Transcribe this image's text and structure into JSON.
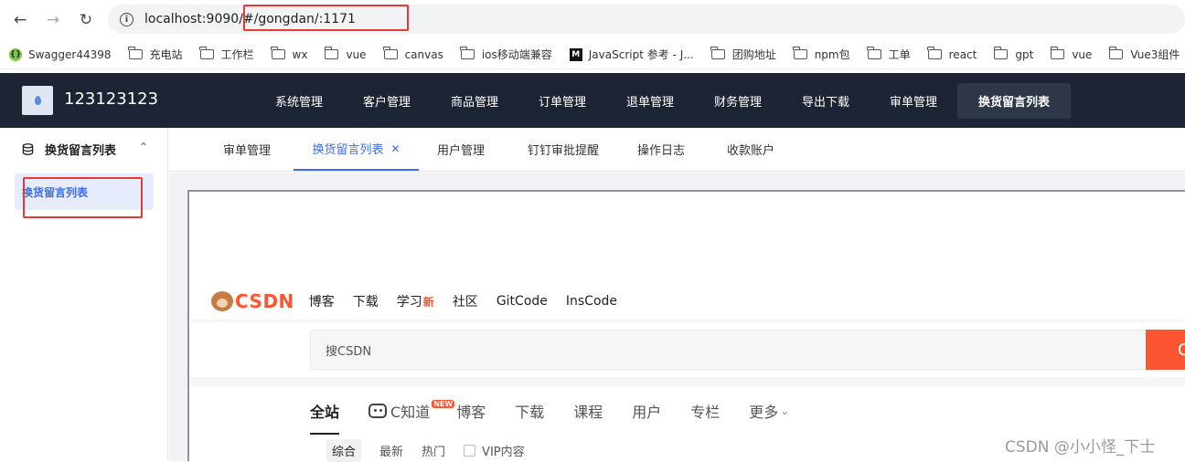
{
  "browser": {
    "url": "localhost:9090/#/gongdan/:1171",
    "bookmarks": [
      {
        "label": "Swagger44398",
        "icon": "swagger-icon"
      },
      {
        "label": "充电站",
        "icon": "folder-icon"
      },
      {
        "label": "工作栏",
        "icon": "folder-icon"
      },
      {
        "label": "wx",
        "icon": "folder-icon"
      },
      {
        "label": "vue",
        "icon": "folder-icon"
      },
      {
        "label": "canvas",
        "icon": "folder-icon"
      },
      {
        "label": "ios移动端兼容",
        "icon": "folder-icon"
      },
      {
        "label": "JavaScript 参考 - J...",
        "icon": "mdn-icon"
      },
      {
        "label": "团购地址",
        "icon": "folder-icon"
      },
      {
        "label": "npm包",
        "icon": "folder-icon"
      },
      {
        "label": "工单",
        "icon": "folder-icon"
      },
      {
        "label": "react",
        "icon": "folder-icon"
      },
      {
        "label": "gpt",
        "icon": "folder-icon"
      },
      {
        "label": "vue",
        "icon": "folder-icon"
      },
      {
        "label": "Vue3组件",
        "icon": "folder-icon"
      }
    ]
  },
  "app": {
    "brand": "123123123",
    "menu": [
      "系统管理",
      "客户管理",
      "商品管理",
      "订单管理",
      "退单管理",
      "财务管理",
      "导出下载",
      "审单管理",
      "换货留言列表"
    ],
    "active_menu": "换货留言列表",
    "sidebar": {
      "group": "换货留言列表",
      "items": [
        "换货留言列表"
      ]
    },
    "tabs": [
      "审单管理",
      "换货留言列表",
      "用户管理",
      "钉钉审批提醒",
      "操作日志",
      "收款账户"
    ],
    "active_tab": "换货留言列表"
  },
  "embedded": {
    "logo": "CSDN",
    "nav": [
      "博客",
      "下载",
      "学习",
      "社区",
      "GitCode",
      "InsCode"
    ],
    "nav_new_tag": "新",
    "search_placeholder": "搜CSDN",
    "search_button": "C",
    "categories": [
      "全站",
      "C知道",
      "博客",
      "下载",
      "课程",
      "用户",
      "专栏",
      "更多"
    ],
    "category_new_badge": "NEW",
    "filters": [
      "综合",
      "最新",
      "热门"
    ],
    "vip_label": "VIP内容"
  },
  "watermark": "CSDN @小小怪_下士",
  "colors": {
    "topnav": "#1d2534",
    "accent": "#3e6bea",
    "csdn_orange": "#fc5531",
    "highlight_box": "#e53935"
  }
}
